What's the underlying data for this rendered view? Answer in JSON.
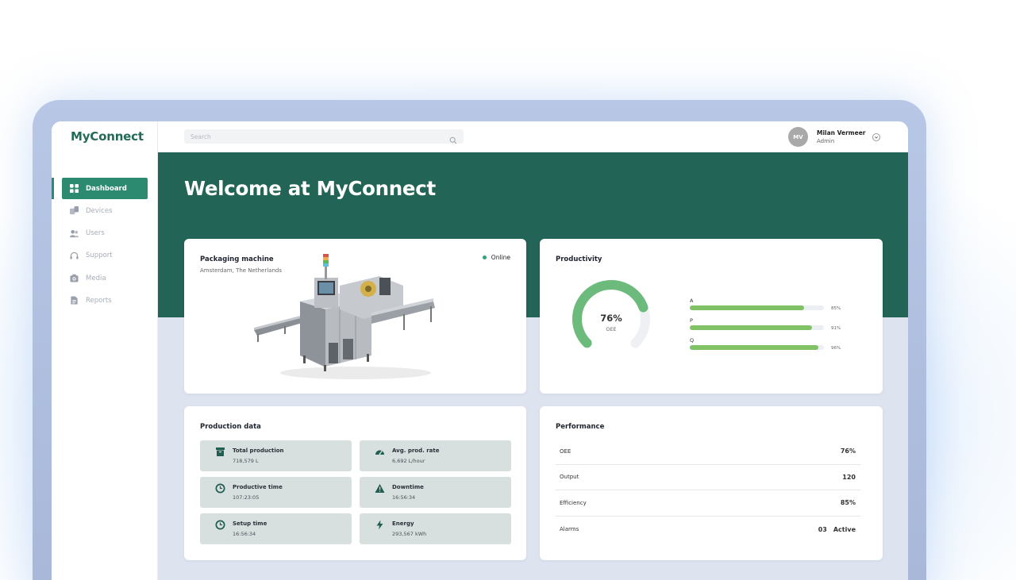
{
  "app": {
    "logo": "MyConnect"
  },
  "sidebar": {
    "items": [
      {
        "label": "Dashboard",
        "icon": "dashboard-icon",
        "active": true
      },
      {
        "label": "Devices",
        "icon": "devices-icon",
        "active": false
      },
      {
        "label": "Users",
        "icon": "users-icon",
        "active": false
      },
      {
        "label": "Support",
        "icon": "headset-icon",
        "active": false
      },
      {
        "label": "Media",
        "icon": "camera-icon",
        "active": false
      },
      {
        "label": "Reports",
        "icon": "document-icon",
        "active": false
      }
    ]
  },
  "header": {
    "search_placeholder": "Search",
    "user": {
      "initials": "MV",
      "name": "Milan Vermeer",
      "role": "Admin"
    }
  },
  "hero": {
    "title": "Welcome at MyConnect"
  },
  "machine_card": {
    "title": "Packaging machine",
    "location": "Amsterdam, The Netherlands",
    "status": "Online"
  },
  "productivity": {
    "title": "Productivity",
    "oee_value": "76%",
    "oee_label": "OEE",
    "oee_fraction": 0.76,
    "bars": [
      {
        "label": "A",
        "pct_text": "85%",
        "value": 0.85
      },
      {
        "label": "P",
        "pct_text": "91%",
        "value": 0.91
      },
      {
        "label": "Q",
        "pct_text": "96%",
        "value": 0.96
      }
    ]
  },
  "production": {
    "title": "Production data",
    "tiles": [
      {
        "label": "Total production",
        "value": "718,579 L",
        "icon": "box-icon"
      },
      {
        "label": "Avg. prod. rate",
        "value": "6,692 L/hour",
        "icon": "speedometer-icon"
      },
      {
        "label": "Productive time",
        "value": "107:23:05",
        "icon": "clock-icon"
      },
      {
        "label": "Downtime",
        "value": "16:56:34",
        "icon": "warning-icon"
      },
      {
        "label": "Setup time",
        "value": "16:56:34",
        "icon": "clock-icon"
      },
      {
        "label": "Energy",
        "value": "293,567 kWh",
        "icon": "bolt-icon"
      }
    ]
  },
  "performance": {
    "title": "Performance",
    "rows": [
      {
        "label": "OEE",
        "value": "76%",
        "extra": ""
      },
      {
        "label": "Output",
        "value": "120",
        "extra": ""
      },
      {
        "label": "Efficiency",
        "value": "85%",
        "extra": ""
      },
      {
        "label": "Alarms",
        "value": "03",
        "extra": "Active"
      }
    ]
  },
  "colors": {
    "brand": "#226455",
    "accent": "#2c8a71",
    "online": "#35a277",
    "bar": "#82c266",
    "gauge": "#6dbb7c"
  }
}
